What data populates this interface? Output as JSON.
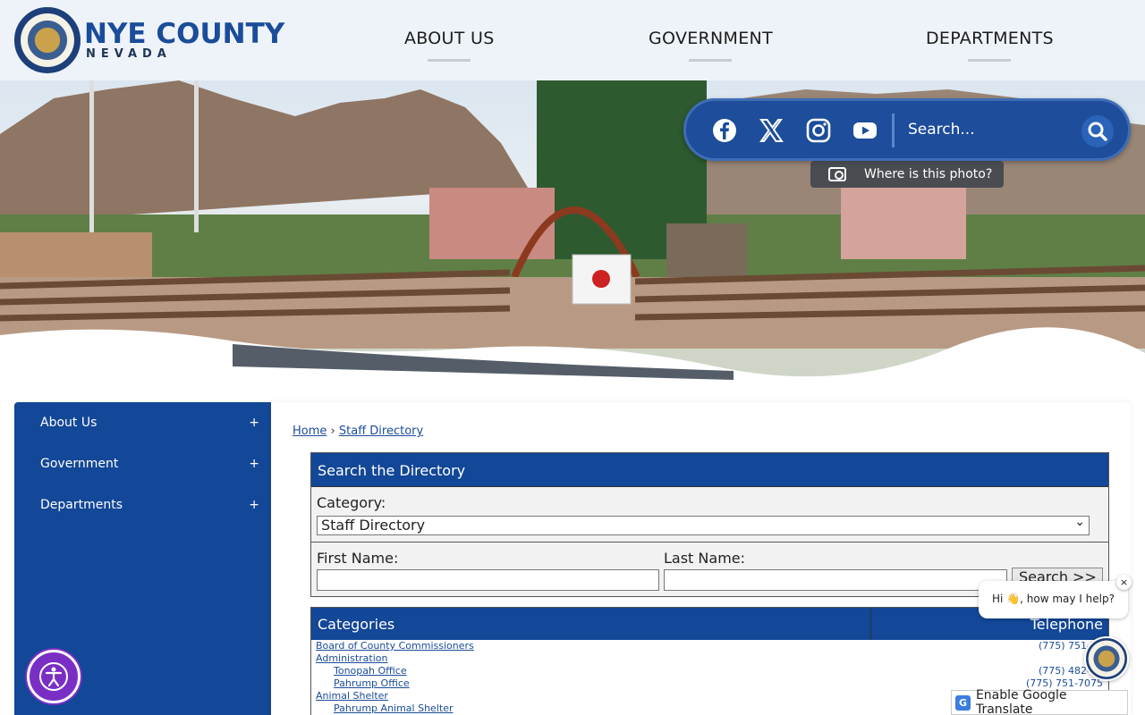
{
  "header": {
    "logo_title": "NYE COUNTY",
    "logo_subtitle": "NEVADA",
    "nav": [
      "ABOUT US",
      "GOVERNMENT",
      "DEPARTMENTS"
    ]
  },
  "hero": {
    "search_placeholder": "Search...",
    "where_photo": "Where is this photo?",
    "social_icons": [
      "facebook-icon",
      "x-icon",
      "instagram-icon",
      "youtube-icon"
    ]
  },
  "sidebar": {
    "items": [
      {
        "label": "About Us",
        "toggle": "+"
      },
      {
        "label": "Government",
        "toggle": "+"
      },
      {
        "label": "Departments",
        "toggle": "+"
      }
    ]
  },
  "breadcrumb": {
    "home": "Home",
    "sep": "›",
    "current": "Staff Directory"
  },
  "directory": {
    "title": "Search the Directory",
    "category_label": "Category:",
    "category_value": "Staff Directory",
    "first_name_label": "First Name:",
    "last_name_label": "Last Name:",
    "search_button": "Search >>"
  },
  "categories": {
    "header": "Categories",
    "telephone_header": "Telephone",
    "rows": [
      {
        "name": "Board of County Commissioners",
        "tel": "(775) 751-70",
        "sub": false
      },
      {
        "name": "Administration",
        "tel": "",
        "sub": false
      },
      {
        "name": "Tonopah Office",
        "tel": "(775) 482-81",
        "sub": true
      },
      {
        "name": "Pahrump Office",
        "tel": "(775) 751-7075",
        "sub": true
      },
      {
        "name": "Animal Shelter",
        "tel": "",
        "sub": false
      },
      {
        "name": "Pahrump Animal Shelter",
        "tel": "",
        "sub": true
      }
    ]
  },
  "chat": {
    "greeting": "Hi 👋, how may I help?",
    "close": "×"
  },
  "translate": {
    "label": "Enable Google Translate",
    "icon_letter": "G"
  },
  "colors": {
    "brand_blue": "#134797",
    "accessibility_purple": "#7a2fc4"
  }
}
